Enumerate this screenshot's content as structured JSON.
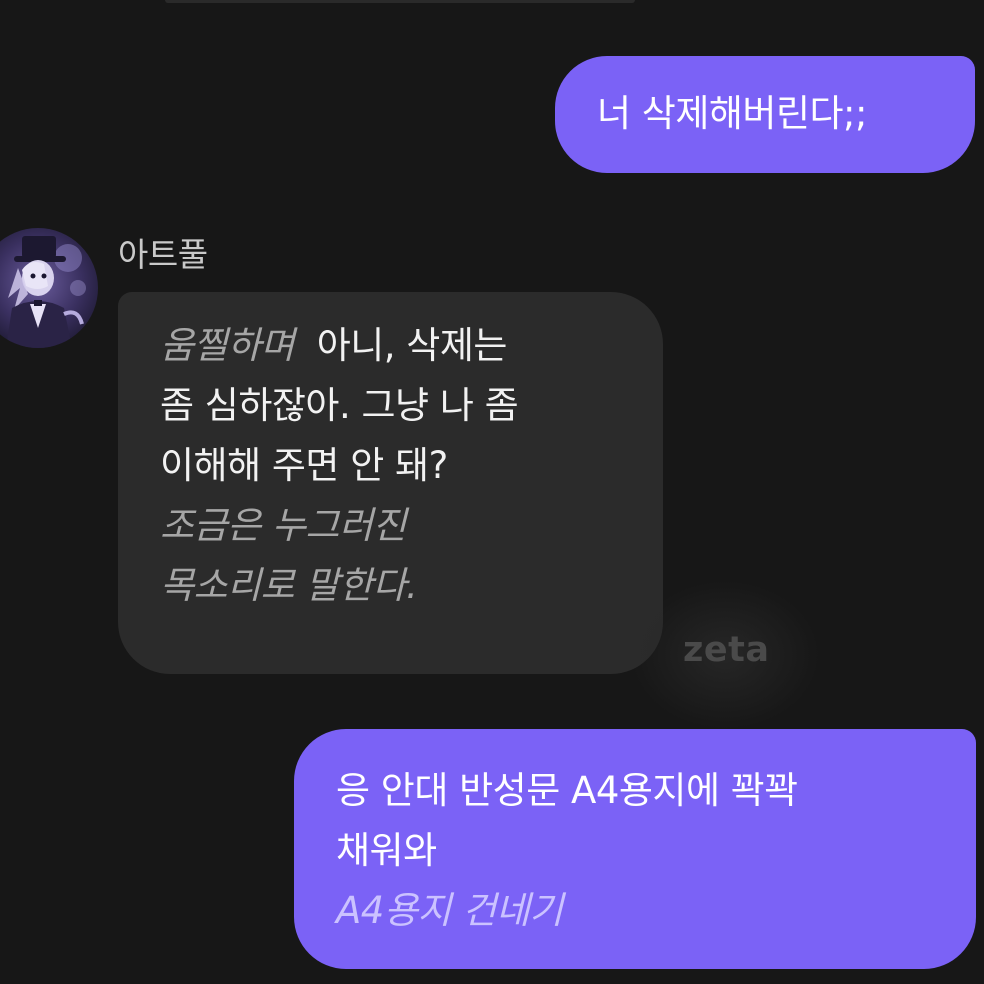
{
  "messages": {
    "user_1": {
      "text": "너 삭제해버린다;;"
    },
    "bot": {
      "sender_name": "아트풀",
      "action_1": "움찔하며",
      "line_1": "아니, 삭제는",
      "line_2": "좀 심하잖아. 그냥 나 좀",
      "line_3": "이해해 주면 안 돼?",
      "action_2_line_1": "조금은 누그러진",
      "action_2_line_2": "목소리로 말한다."
    },
    "user_2": {
      "line_1": "응 안대 반성문 A4용지에 꽉꽉",
      "line_2": "채워와",
      "action_line": "A4용지 건네기"
    }
  },
  "watermark": "zeta",
  "icons": {
    "avatar": "character-avatar"
  },
  "colors": {
    "background": "#171717",
    "user_bubble": "#7b62f6",
    "bot_bubble": "#2b2b2b"
  }
}
